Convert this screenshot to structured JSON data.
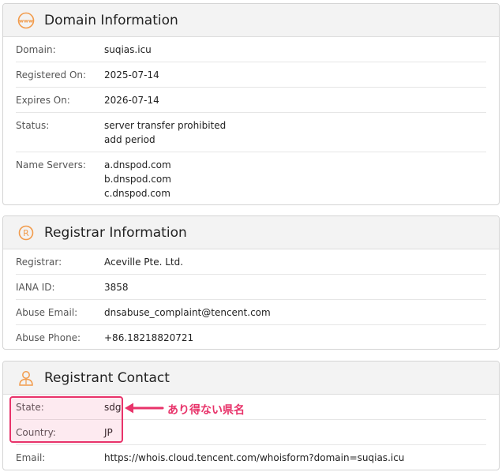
{
  "domain_info": {
    "title": "Domain Information",
    "icon": "www-icon",
    "rows": [
      {
        "label": "Domain:",
        "values": [
          "suqias.icu"
        ]
      },
      {
        "label": "Registered On:",
        "values": [
          "2025-07-14"
        ]
      },
      {
        "label": "Expires On:",
        "values": [
          "2026-07-14"
        ]
      },
      {
        "label": "Status:",
        "values": [
          "server transfer prohibited",
          "add period"
        ]
      },
      {
        "label": "Name Servers:",
        "values": [
          "a.dnspod.com",
          "b.dnspod.com",
          "c.dnspod.com"
        ]
      }
    ]
  },
  "registrar_info": {
    "title": "Registrar Information",
    "icon": "registered-icon",
    "rows": [
      {
        "label": "Registrar:",
        "values": [
          "Aceville Pte. Ltd."
        ]
      },
      {
        "label": "IANA ID:",
        "values": [
          "3858"
        ]
      },
      {
        "label": "Abuse Email:",
        "values": [
          "dnsabuse_complaint@tencent.com"
        ]
      },
      {
        "label": "Abuse Phone:",
        "values": [
          "+86.18218820721"
        ]
      }
    ]
  },
  "registrant_contact": {
    "title": "Registrant Contact",
    "icon": "person-icon",
    "rows": [
      {
        "label": "State:",
        "values": [
          "sdg"
        ]
      },
      {
        "label": "Country:",
        "values": [
          "JP"
        ]
      },
      {
        "label": "Email:",
        "values": [
          "https://whois.cloud.tencent.com/whoisform?domain=suqias.icu"
        ]
      }
    ]
  },
  "annotation": {
    "text": "あり得ない県名",
    "color": "#e8336a"
  },
  "colors": {
    "accent": "#f29b4b",
    "highlight": "#e8336a"
  }
}
